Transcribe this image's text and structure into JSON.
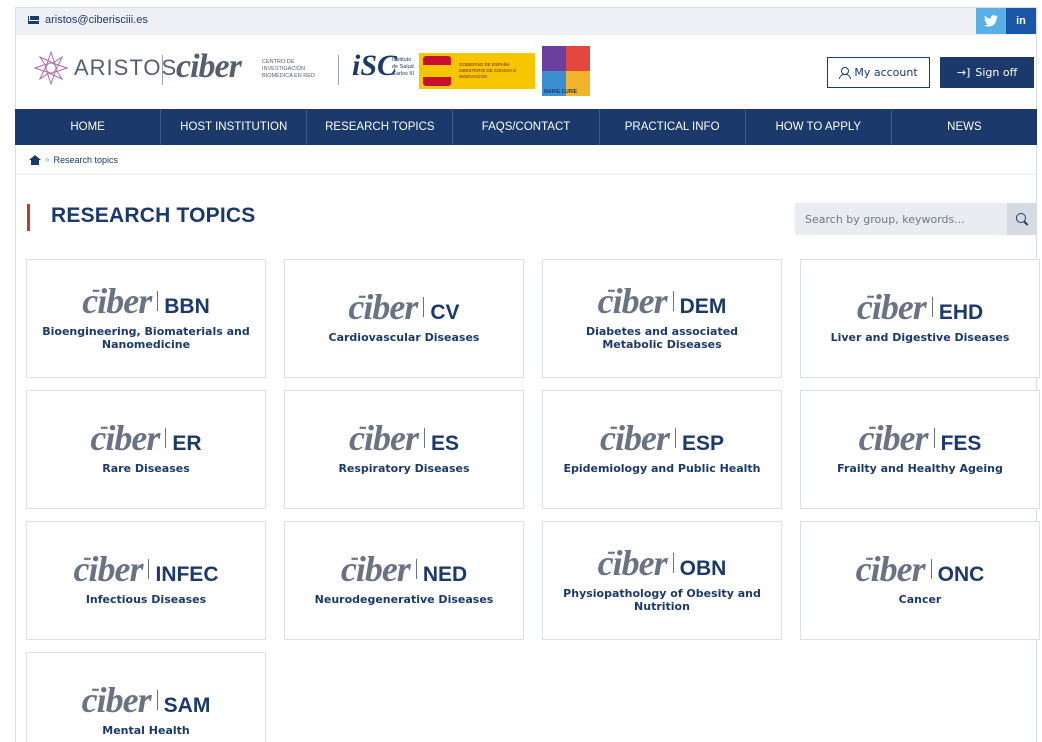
{
  "topbar": {
    "email": "aristos@ciberisciii.es",
    "twitter_icon": "twitter-icon",
    "linkedin_icon": "linkedin-icon",
    "linkedin_glyph": "in"
  },
  "header": {
    "aristos_text": "ARISTOS",
    "ciber_logo_text": "ciber",
    "ciber_sub": "CENTRO DE INVESTIGACIÓN BIOMÉDICA EN RED",
    "isc_logo_text": "iSC",
    "isc_sub": "Instituto de Salud Carlos III",
    "gov_text": "GOBIERNO DE ESPAÑA   MINISTERIO DE CIENCIA E INNOVACIÓN",
    "mc_text": "MARIE CURIE",
    "my_account": "My account",
    "sign_off": "Sign off",
    "signoff_glyph": "→]"
  },
  "nav": {
    "items": [
      "HOME",
      "HOST INSTITUTION",
      "RESEARCH TOPICS",
      "FAQS/CONTACT",
      "PRACTICAL INFO",
      "HOW TO APPLY",
      "NEWS"
    ]
  },
  "breadcrumb": {
    "sep": "»",
    "current": "Research topics"
  },
  "page": {
    "title": "RESEARCH TOPICS",
    "search_placeholder": "Search by group, keywords..."
  },
  "cards": [
    {
      "brand": "ciber",
      "code": "BBN",
      "desc": "Bioengineering, Biomaterials and Nanomedicine"
    },
    {
      "brand": "ciber",
      "code": "CV",
      "desc": "Cardiovascular Diseases"
    },
    {
      "brand": "ciber",
      "code": "DEM",
      "desc": "Diabetes and associated Metabolic Diseases"
    },
    {
      "brand": "ciber",
      "code": "EHD",
      "desc": "Liver and Digestive Diseases"
    },
    {
      "brand": "ciber",
      "code": "ER",
      "desc": "Rare Diseases"
    },
    {
      "brand": "ciber",
      "code": "ES",
      "desc": "Respiratory Diseases"
    },
    {
      "brand": "ciber",
      "code": "ESP",
      "desc": "Epidemiology and Public Health"
    },
    {
      "brand": "ciber",
      "code": "FES",
      "desc": "Frailty and Healthy Ageing"
    },
    {
      "brand": "ciber",
      "code": "INFEC",
      "desc": "Infectious Diseases"
    },
    {
      "brand": "ciber",
      "code": "NED",
      "desc": "Neurodegenerative Diseases"
    },
    {
      "brand": "ciber",
      "code": "OBN",
      "desc": "Physiopathology of Obesity and Nutrition"
    },
    {
      "brand": "ciber",
      "code": "ONC",
      "desc": "Cancer"
    },
    {
      "brand": "ciber",
      "code": "SAM",
      "desc": "Mental Health"
    }
  ],
  "colors": {
    "brand_navy": "#1b3a6b",
    "accent_red": "#c0392b",
    "twitter": "#58b0e6",
    "linkedin": "#1a56a8"
  }
}
